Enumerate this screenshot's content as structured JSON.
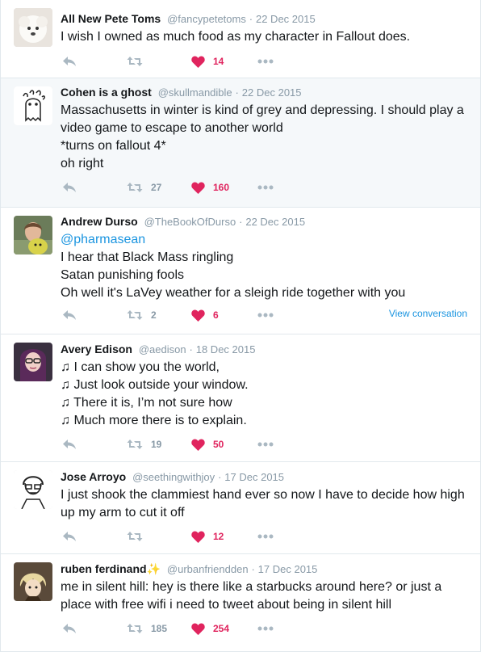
{
  "tweets": [
    {
      "name": "All New Pete Toms",
      "handle": "@fancypetetoms",
      "sep": "·",
      "time": "22 Dec 2015",
      "lines": [
        "I wish I owned as much food as my character in Fallout does."
      ],
      "retweets": "",
      "likes": "14"
    },
    {
      "name": "Cohen is a ghost",
      "handle": "@skullmandible",
      "sep": "·",
      "time": "22 Dec 2015",
      "lines": [
        "Massachusetts in winter is kind of grey and depressing. I should play a",
        "video game to escape to another world",
        "*turns on fallout 4*",
        "oh right"
      ],
      "retweets": "27",
      "likes": "160"
    },
    {
      "name": "Andrew Durso",
      "handle": "@TheBookOfDurso",
      "sep": "·",
      "time": "22 Dec 2015",
      "mention": "@pharmasean",
      "lines": [
        "I hear that Black Mass ringling",
        "Satan punishing fools",
        "Oh well it's LaVey weather for a sleigh ride together with you"
      ],
      "retweets": "2",
      "likes": "6",
      "view_conversation": "View conversation"
    },
    {
      "name": "Avery Edison",
      "handle": "@aedison",
      "sep": "·",
      "time": "18 Dec 2015",
      "lines": [
        "♫ I can show you the world,",
        "♫ Just look outside your window.",
        "♫ There it is, I’m not sure how",
        "♫ Much more there is to explain."
      ],
      "retweets": "19",
      "likes": "50"
    },
    {
      "name": "Jose Arroyo",
      "handle": "@seethingwithjoy",
      "sep": "·",
      "time": "17 Dec 2015",
      "lines": [
        "I just shook the clammiest hand ever so now I have to decide how high",
        "up my arm to cut it off"
      ],
      "retweets": "",
      "likes": "12"
    },
    {
      "name": "ruben ferdinand",
      "name_emoji": "✨",
      "handle": "@urbanfriendden",
      "sep": "·",
      "time": "17 Dec 2015",
      "lines": [
        "me in silent hill: hey is there like a starbucks around here? or just a",
        "place with free wifi i need to tweet about being in silent hill"
      ],
      "retweets": "185",
      "likes": "254"
    }
  ],
  "icons": {
    "reply": "reply-icon",
    "retweet": "retweet-icon",
    "like": "heart-icon",
    "more": "more-icon"
  },
  "colors": {
    "like": "#e0245e",
    "link": "#1b95e0",
    "muted": "#8899a6",
    "highlight_bg": "#f5f8fa",
    "border": "#e1e8ed"
  }
}
